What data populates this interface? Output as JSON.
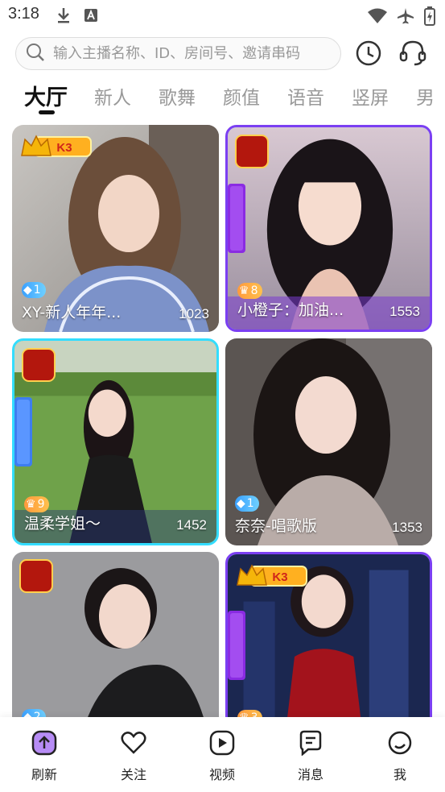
{
  "status": {
    "time": "3:18"
  },
  "search": {
    "placeholder": "输入主播名称、ID、房间号、邀请串码"
  },
  "header_icons": {
    "history": "clock-icon",
    "service": "headset-icon"
  },
  "tabs": [
    {
      "label": "大厅",
      "active": true
    },
    {
      "label": "新人"
    },
    {
      "label": "歌舞"
    },
    {
      "label": "颜值"
    },
    {
      "label": "语音"
    },
    {
      "label": "竖屏"
    },
    {
      "label": "男"
    }
  ],
  "cards": [
    {
      "title": "XY-新人年年...",
      "count": "1023",
      "level": "1",
      "level_type": "diamond",
      "badge": "K3"
    },
    {
      "title": "小橙子：加油...",
      "count": "1553",
      "level": "8",
      "level_type": "crown",
      "badge": "笑傲江湖",
      "side_banner": "C位之星"
    },
    {
      "title": "温柔学姐～",
      "count": "1452",
      "level": "9",
      "level_type": "crown",
      "badge": "笑傲江湖",
      "side_banner": "C位练习生"
    },
    {
      "title": "奈奈-唱歌版",
      "count": "1353",
      "level": "1",
      "level_type": "diamond"
    },
    {
      "title": "",
      "count": "",
      "level": "2",
      "level_type": "diamond",
      "badge": "笑傲江湖"
    },
    {
      "title": "",
      "count": "",
      "level": "3",
      "level_type": "crown",
      "badge": "K3",
      "side_banner": "C位之星"
    }
  ],
  "nav": [
    {
      "label": "刷新",
      "icon": "refresh-up-icon"
    },
    {
      "label": "关注",
      "icon": "heart-icon"
    },
    {
      "label": "视频",
      "icon": "play-icon"
    },
    {
      "label": "消息",
      "icon": "message-icon"
    },
    {
      "label": "我",
      "icon": "profile-icon"
    }
  ],
  "colors": {
    "accent": "#7b3ff2",
    "frame_cyan": "#33ddff",
    "active_tab": "#111111",
    "inactive_tab": "#999999"
  }
}
